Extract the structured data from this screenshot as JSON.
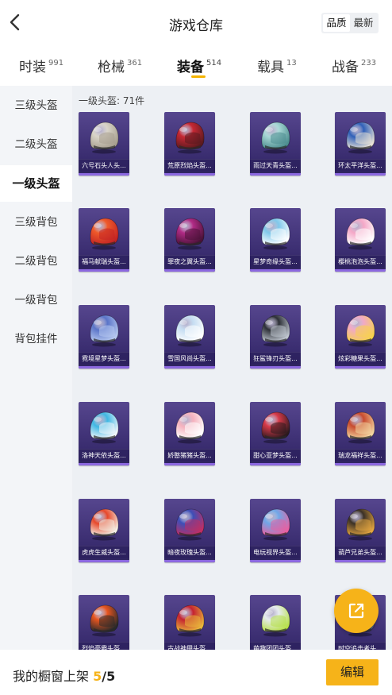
{
  "header": {
    "title": "游戏仓库",
    "sort_options": [
      "品质",
      "最新"
    ],
    "active_sort": "品质"
  },
  "tabs": [
    {
      "label": "时装",
      "count": "991"
    },
    {
      "label": "枪械",
      "count": "361"
    },
    {
      "label": "装备",
      "count": "514",
      "active": true
    },
    {
      "label": "载具",
      "count": "13"
    },
    {
      "label": "战备",
      "count": "233"
    }
  ],
  "sidebar": {
    "items": [
      {
        "label": "三级头盔"
      },
      {
        "label": "二级头盔"
      },
      {
        "label": "一级头盔",
        "active": true
      },
      {
        "label": "三级背包"
      },
      {
        "label": "二级背包"
      },
      {
        "label": "一级背包"
      },
      {
        "label": "背包挂件"
      }
    ]
  },
  "content": {
    "section_label": "一级头盔: 71件",
    "items": [
      {
        "name": "六号石头人头...",
        "colors": [
          "#d9d4c8",
          "#a79f8f"
        ]
      },
      {
        "name": "荒原烈焰头盔...",
        "colors": [
          "#c62834",
          "#5a1a1f"
        ]
      },
      {
        "name": "雨过天青头盔...",
        "colors": [
          "#a9d8d6",
          "#4c8d8f"
        ]
      },
      {
        "name": "环太平洋头盔...",
        "colors": [
          "#2f5fb8",
          "#e8e2d6"
        ]
      },
      {
        "name": "福马献瑞头盔...",
        "colors": [
          "#ef5a2a",
          "#c22424"
        ]
      },
      {
        "name": "罪夜之翼头盔...",
        "colors": [
          "#b12b86",
          "#4a1238"
        ]
      },
      {
        "name": "星梦奇缘头盔...",
        "colors": [
          "#7fc8ea",
          "#ffffff"
        ]
      },
      {
        "name": "樱桃泡泡头盔...",
        "colors": [
          "#f4a7c7",
          "#ffffff"
        ]
      },
      {
        "name": "霓境星梦头盔...",
        "colors": [
          "#5a74c8",
          "#b7c9f0"
        ]
      },
      {
        "name": "雪国风尚头盔...",
        "colors": [
          "#c5ddf2",
          "#ffffff"
        ]
      },
      {
        "name": "狂鲨锋刃头盔...",
        "colors": [
          "#2c2f36",
          "#bfc6cf"
        ]
      },
      {
        "name": "炫彩糖果头盔...",
        "colors": [
          "#f1a9c6",
          "#f7d34b"
        ]
      },
      {
        "name": "洛神天依头盔...",
        "colors": [
          "#3fb7e3",
          "#f2f7fb"
        ]
      },
      {
        "name": "娇憨猪猪头盔...",
        "colors": [
          "#f5b1bd",
          "#ffffff"
        ]
      },
      {
        "name": "甜心亚梦头盔...",
        "colors": [
          "#d93a49",
          "#2b1a1e"
        ]
      },
      {
        "name": "瑞龙福祥头盔...",
        "colors": [
          "#c84a2e",
          "#f3d6a0"
        ]
      },
      {
        "name": "虎虎生威头盔...",
        "colors": [
          "#e7472a",
          "#f3f0e6"
        ]
      },
      {
        "name": "暗夜玫瑰头盔...",
        "colors": [
          "#3d4fb8",
          "#c12e63"
        ]
      },
      {
        "name": "电玩视界头盔...",
        "colors": [
          "#6fa7e8",
          "#e95fa0"
        ]
      },
      {
        "name": "葫芦兄弟头盔...",
        "colors": [
          "#3a3026",
          "#e3a540"
        ]
      },
      {
        "name": "烈焰豪霸头盔...",
        "colors": [
          "#e9551f",
          "#2a2a2a"
        ]
      },
      {
        "name": "古战神甲头盔...",
        "colors": [
          "#c52231",
          "#e9b73b"
        ]
      },
      {
        "name": "萌趣团团头盔...",
        "colors": [
          "#e6ecef",
          "#b7e04a"
        ]
      },
      {
        "name": "时空追击者头...",
        "colors": [
          "#c2c5cc",
          "#4f5d80"
        ]
      }
    ]
  },
  "footer": {
    "label": "我的橱窗上架",
    "count": "5",
    "total": "/5",
    "edit_label": "编辑"
  },
  "fab": {
    "icon": "share-external-icon"
  }
}
